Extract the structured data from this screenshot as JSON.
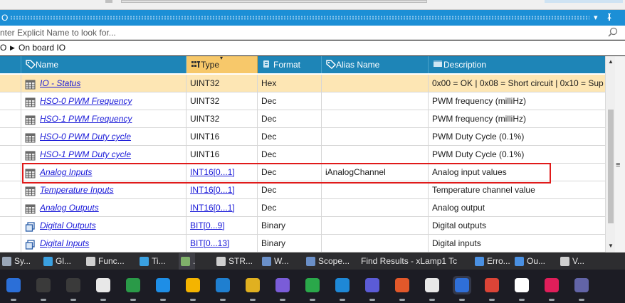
{
  "panel": {
    "title": "O"
  },
  "search": {
    "placeholder": "nter Explicit Name to look for..."
  },
  "breadcrumb": {
    "root": "O",
    "current": "On board IO"
  },
  "columns": {
    "name": "Name",
    "type": "Type",
    "format": "Format",
    "alias": "Alias Name",
    "description": "Description"
  },
  "rows": [
    {
      "name": "IO - Status",
      "type": "UINT32",
      "format": "Hex",
      "alias": "",
      "description": "0x00 = OK | 0x08 = Short circuit | 0x10 = Sup",
      "type_link": false
    },
    {
      "name": "HSO-0 PWM Frequency",
      "type": "UINT32",
      "format": "Dec",
      "alias": "",
      "description": "PWM frequency (milliHz)",
      "type_link": false
    },
    {
      "name": "HSO-1 PWM Frequency",
      "type": "UINT32",
      "format": "Dec",
      "alias": "",
      "description": "PWM frequency (milliHz)",
      "type_link": false
    },
    {
      "name": "HSO-0 PWM Duty cycle",
      "type": "UINT16",
      "format": "Dec",
      "alias": "",
      "description": "PWM Duty Cycle (0.1%)",
      "type_link": false
    },
    {
      "name": "HSO-1 PWM Duty cycle",
      "type": "UINT16",
      "format": "Dec",
      "alias": "",
      "description": "PWM Duty Cycle (0.1%)",
      "type_link": false
    },
    {
      "name": "Analog Inputs",
      "type": "INT16[0...1]",
      "format": "Dec",
      "alias": "iAnalogChannel",
      "description": "Analog input values",
      "type_link": true
    },
    {
      "name": "Temperature Inputs",
      "type": "INT16[0...1]",
      "format": "Dec",
      "alias": "",
      "description": "Temperature channel value",
      "type_link": true
    },
    {
      "name": "Analog Outputs",
      "type": "INT16[0...1]",
      "format": "Dec",
      "alias": "",
      "description": "Analog output",
      "type_link": true
    },
    {
      "name": "Digital Outputs",
      "type": "BIT[0...9]",
      "format": "Binary",
      "alias": "",
      "description": "Digital outputs",
      "type_link": true
    },
    {
      "name": "Digital Inputs",
      "type": "BIT[0...13]",
      "format": "Binary",
      "alias": "",
      "description": "Digital inputs",
      "type_link": true
    }
  ],
  "tabs": [
    {
      "label": "Sy...",
      "icon": "gear-icon"
    },
    {
      "label": "Gl...",
      "icon": "globe-icon"
    },
    {
      "label": "Func...",
      "icon": "function-icon"
    },
    {
      "label": "Ti...",
      "icon": "timer-icon"
    },
    {
      "label": ".",
      "icon": "terminal-icon"
    },
    {
      "label": "STR...",
      "icon": "struct-icon"
    },
    {
      "label": "W...",
      "icon": "watch-icon"
    },
    {
      "label": "Scope...",
      "icon": "scope-icon"
    },
    {
      "label": "Find Results - xLamp1 Tc",
      "icon": ""
    },
    {
      "label": "Erro...",
      "icon": "error-list-icon"
    },
    {
      "label": "Ou...",
      "icon": "output-icon"
    },
    {
      "label": "V...",
      "icon": "variables-icon"
    }
  ],
  "colors": {
    "title_bar": "#1c8fd6",
    "header": "#1e85b7",
    "sorted_header": "#f7c86a",
    "selected_row": "#fde6b4",
    "link": "#1a1ad8",
    "highlight": "#e01a1a"
  },
  "taskbar_apps": [
    "powershell-icon",
    "terminal-icon",
    "cmd-icon",
    "gmail-icon",
    "sketch-app-icon",
    "vscode-icon",
    "drive-icon",
    "shark-icon",
    "photo-app-icon",
    "copilot-icon",
    "xbox-icon",
    "sync-icon",
    "notes-icon",
    "spark-icon",
    "openai-icon",
    "mail-app-icon",
    "chrome-icon",
    "autodesk-icon",
    "slack-icon",
    "teams-icon"
  ]
}
